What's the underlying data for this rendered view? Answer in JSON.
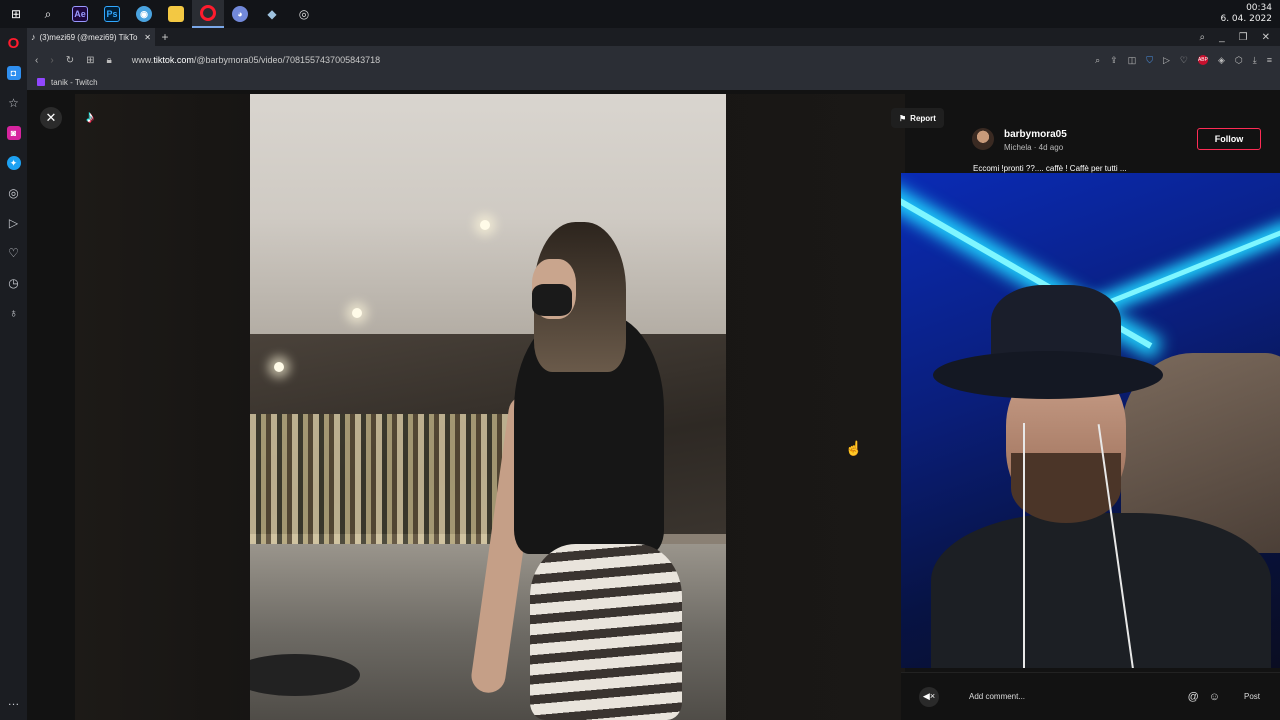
{
  "taskbar": {
    "apps": [
      {
        "name": "windows-start-icon",
        "glyph": "⊞",
        "color": "#ffffff"
      },
      {
        "name": "search-icon",
        "glyph": "⌕",
        "color": "#ffffff"
      },
      {
        "name": "after-effects-icon",
        "glyph": "Ae",
        "color": "#9999ff"
      },
      {
        "name": "photoshop-icon",
        "glyph": "Ps",
        "color": "#31a8ff"
      },
      {
        "name": "chrome-icon",
        "glyph": "◉",
        "color": "#4aa3df"
      },
      {
        "name": "file-explorer-icon",
        "glyph": "▬",
        "color": "#f3c843"
      },
      {
        "name": "opera-icon",
        "glyph": "O",
        "color": "#ff1b2d"
      },
      {
        "name": "discord-icon",
        "glyph": "◕",
        "color": "#7289da"
      },
      {
        "name": "app-icon",
        "glyph": "◆",
        "color": "#9fc3e0"
      },
      {
        "name": "obs-icon",
        "glyph": "◎",
        "color": "#dddddd"
      }
    ],
    "clock_time": "00:34",
    "clock_date": "6. 04. 2022"
  },
  "browser": {
    "tab_title": "(3)mezi69 (@mezi69) TikTo",
    "url_prefix": "www.",
    "url_domain": "tiktok.com",
    "url_path": "/@barbymora05/video/7081557437005843718",
    "bookmark": "tanik - Twitch",
    "brand_color": "#ff1b2d"
  },
  "sidebar_icons": [
    "messenger-icon",
    "star-icon",
    "instagram-icon",
    "twitter-icon",
    "player-icon",
    "send-icon",
    "heart-icon",
    "history-icon",
    "bulb-icon",
    "more-icon"
  ],
  "tiktok": {
    "report_label": "Report",
    "username": "barbymora05",
    "subline": "Michela · 4d ago",
    "follow_label": "Follow",
    "caption": "Eccomi !pronti ??.... caffè ! Caffè per tutti ...",
    "add_comment": "Add comment...",
    "post_label": "Post",
    "accent_color": "#fe2c55"
  }
}
